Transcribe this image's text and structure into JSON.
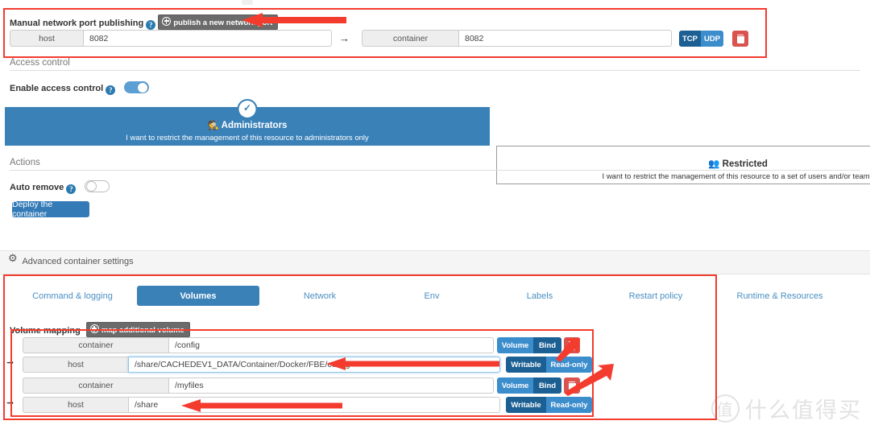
{
  "port_publishing": {
    "label": "Manual network port publishing",
    "help_icon": "help-icon",
    "add_button": "publish a new network port",
    "rows": [
      {
        "host_addon": "host",
        "host_value": "8082",
        "arrow": "→",
        "container_addon": "container",
        "container_value": "8082",
        "protocols": [
          "TCP",
          "UDP"
        ],
        "protocol_selected": "TCP",
        "delete_icon": "trash-icon"
      }
    ]
  },
  "access_control": {
    "section_title": "Access control",
    "toggle_label": "Enable access control",
    "toggle_state": "on",
    "cards": [
      {
        "title": "Administrators",
        "subtitle": "I want to restrict the management of this resource to administrators only",
        "icon": "administrators-icon",
        "selected": true,
        "check_icon": "✓"
      },
      {
        "title": "Restricted",
        "subtitle": "I want to restrict the management of this resource to a set of users and/or teams",
        "icon": "users-group-icon",
        "selected": false
      }
    ]
  },
  "actions": {
    "section_title": "Actions",
    "auto_remove_label": "Auto remove",
    "auto_remove_state": "off",
    "deploy_button": "Deploy the container"
  },
  "advanced": {
    "header": "Advanced container settings",
    "gear_icon": "gear-icon",
    "tabs": [
      {
        "label": "Command & logging",
        "active": false
      },
      {
        "label": "Volumes",
        "active": true
      },
      {
        "label": "Network",
        "active": false
      },
      {
        "label": "Env",
        "active": false
      },
      {
        "label": "Labels",
        "active": false
      },
      {
        "label": "Restart policy",
        "active": false
      },
      {
        "label": "Runtime & Resources",
        "active": false
      }
    ]
  },
  "volumes": {
    "label": "Volume mapping",
    "add_button": "map additional volume",
    "mappings": [
      {
        "container_addon": "container",
        "container_value": "/config",
        "host_addon": "host",
        "host_value": "/share/CACHEDEV1_DATA/Container/Docker/FBE/config",
        "host_focused": true,
        "type_options": [
          "Volume",
          "Bind"
        ],
        "type_selected": "Bind",
        "access_options": [
          "Writable",
          "Read-only"
        ],
        "access_selected": "Writable",
        "delete_icon": "trash-icon"
      },
      {
        "container_addon": "container",
        "container_value": "/myfiles",
        "host_addon": "host",
        "host_value": "/share",
        "host_focused": false,
        "type_options": [
          "Volume",
          "Bind"
        ],
        "type_selected": "Bind",
        "access_options": [
          "Writable",
          "Read-only"
        ],
        "access_selected": "Writable",
        "delete_icon": "trash-icon"
      }
    ]
  },
  "watermark": {
    "mark": "值",
    "text": "什么值得买"
  },
  "colors": {
    "accent_blue": "#337ab7",
    "selected_blue": "#1c5f92",
    "light_blue": "#3c8dcc",
    "danger_red": "#d9534f",
    "annotation_red": "#f33b2e",
    "panel_gray": "#eeeeee"
  }
}
